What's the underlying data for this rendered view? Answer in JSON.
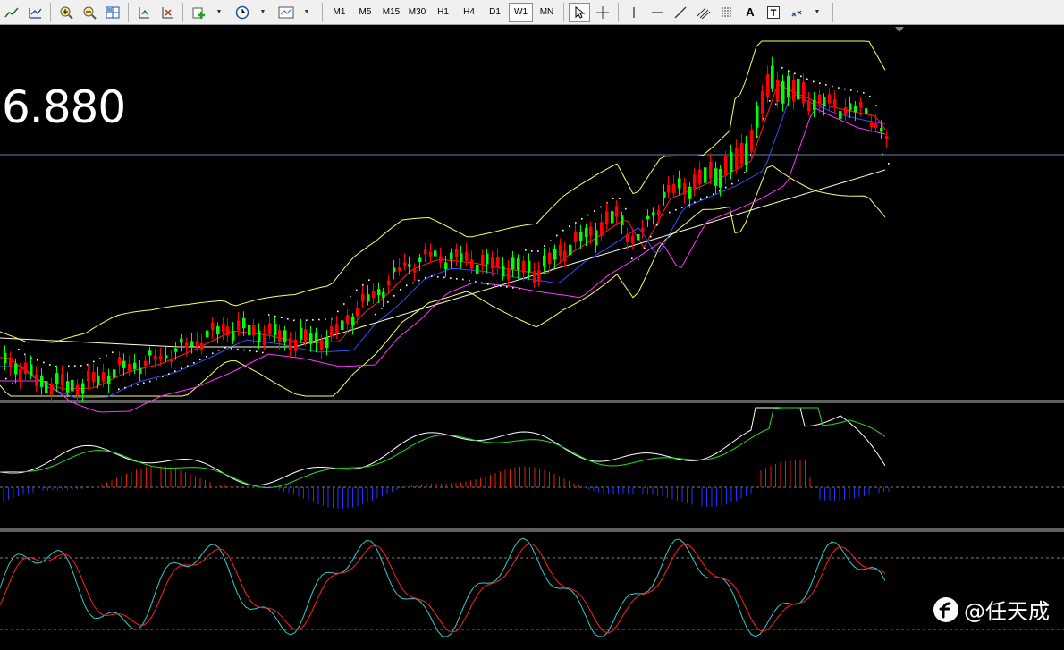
{
  "toolbar": {
    "timeframes": [
      "M1",
      "M5",
      "M15",
      "M30",
      "H1",
      "H4",
      "D1",
      "W1",
      "MN"
    ],
    "active_timeframe": "W1",
    "text_tool_label": "A",
    "text_label_tool": "T"
  },
  "chart": {
    "price_label": "6.880",
    "background": "#000000",
    "colors": {
      "bull": "#00ff00",
      "bear": "#ff0000",
      "bollinger": "#ffff66",
      "ma_fast": "#ff2020",
      "ma_mid": "#3050ff",
      "ma_slow": "#ff33ff",
      "ma_long": "#ffffcc",
      "sar": "#ffffff",
      "macd_main": "#ffffff",
      "macd_signal": "#22dd22",
      "hist_up": "#dd2200",
      "hist_down": "#2233ff",
      "kd_k": "#33cccc",
      "kd_d": "#ff2020"
    }
  },
  "watermark": {
    "text": "@任天成",
    "logo_icon": "feather-f-logo"
  }
}
